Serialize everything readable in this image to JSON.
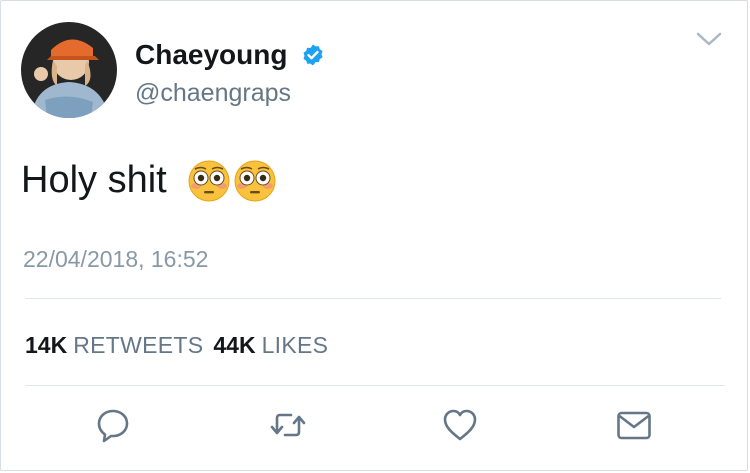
{
  "user": {
    "display_name": "Chaeyoung",
    "handle": "@chaengraps"
  },
  "tweet": {
    "text": "Holy shit",
    "emoji": "flushed-face-emoji x2",
    "timestamp": "22/04/2018, 16:52"
  },
  "stats": {
    "retweets_count": "14K",
    "retweets_label": "RETWEETS",
    "likes_count": "44K",
    "likes_label": "LIKES"
  },
  "actions": {
    "reply_icon": "reply-icon",
    "retweet_icon": "retweet-icon",
    "like_icon": "heart-icon",
    "message_icon": "envelope-icon"
  },
  "colors": {
    "text_primary": "#14171a",
    "text_secondary": "#657786",
    "timestamp": "#8899a6",
    "verified_blue": "#1da1f2",
    "divider": "#e1e8ed"
  }
}
